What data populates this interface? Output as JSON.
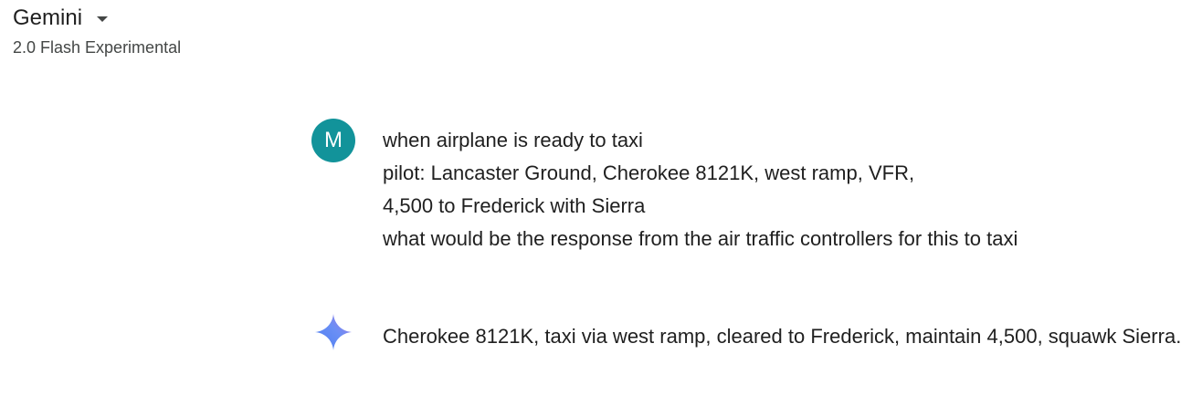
{
  "header": {
    "app_title": "Gemini",
    "model_name": "2.0 Flash Experimental"
  },
  "user": {
    "avatar_letter": "M",
    "avatar_color": "#12939a",
    "message_lines": [
      "when airplane is ready to taxi",
      "pilot: Lancaster Ground, Cherokee 8121K, west ramp, VFR,",
      "4,500 to Frederick with Sierra",
      "what would be the response from the air traffic controllers for this to taxi"
    ]
  },
  "response": {
    "icon": "gemini-sparkle-icon",
    "text": "Cherokee 8121K, taxi via west ramp, cleared to Frederick, maintain 4,500, squawk Sierra."
  }
}
